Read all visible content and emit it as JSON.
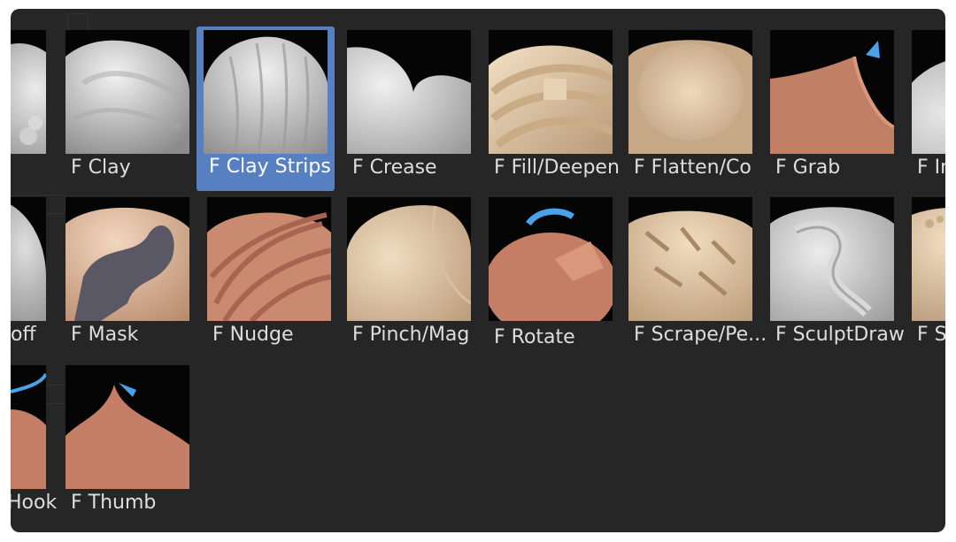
{
  "brushes": [
    {
      "label": "",
      "icon": "fragment-icon"
    },
    {
      "label": "F Clay",
      "icon": "clay-brush-icon"
    },
    {
      "label": "F Clay Strips",
      "icon": "clay-strips-brush-icon",
      "selected": true
    },
    {
      "label": "F Crease",
      "icon": "crease-brush-icon"
    },
    {
      "label": "F Fill/Deepen",
      "icon": "fill-deepen-brush-icon"
    },
    {
      "label": "F Flatten/Co",
      "icon": "flatten-brush-icon"
    },
    {
      "label": "F Grab",
      "icon": "grab-brush-icon"
    },
    {
      "label": "F In",
      "icon": "inflate-brush-icon"
    },
    {
      "label": "off",
      "icon": "fragment-icon"
    },
    {
      "label": "F Mask",
      "icon": "mask-brush-icon"
    },
    {
      "label": "F Nudge",
      "icon": "nudge-brush-icon"
    },
    {
      "label": "F Pinch/Mag",
      "icon": "pinch-brush-icon"
    },
    {
      "label": "F Rotate",
      "icon": "rotate-brush-icon"
    },
    {
      "label": "F Scrape/Pe...",
      "icon": "scrape-brush-icon"
    },
    {
      "label": "F SculptDraw",
      "icon": "sculptdraw-brush-icon"
    },
    {
      "label": "F S",
      "icon": "smooth-brush-icon"
    },
    {
      "label": "Hook",
      "icon": "snake-hook-brush-icon"
    },
    {
      "label": "F Thumb",
      "icon": "thumb-brush-icon"
    }
  ]
}
